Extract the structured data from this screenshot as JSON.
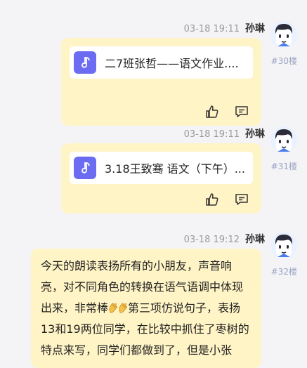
{
  "posts": [
    {
      "time": "03-18 19:11",
      "author": "孙琳",
      "floor": "#30楼",
      "attachment": "二7班张哲——语文作业...."
    },
    {
      "time": "03-18 19:11",
      "author": "孙琳",
      "floor": "#31楼",
      "attachment": "3.18王致骞 语文（下午）..."
    },
    {
      "time": "03-18 19:12",
      "author": "孙琳",
      "floor": "#32楼",
      "text_before": "今天的朗读表扬所有的小朋友，声音响亮，对不同角色的转换在语气语调中体现出来，非常棒",
      "text_after": "第三项仿说句子，表扬13和19两位同学，在比较中抓住了枣树的特点来写，同学们都做到了，但是小张"
    }
  ],
  "icons": {
    "attachment": "music-note-icon",
    "like": "thumbs-up-icon",
    "comment": "comment-icon",
    "emoji": "clapping-hands-icon"
  },
  "colors": {
    "bubble": "#fff4c6",
    "music_icon_bg": "#6c6cf3",
    "floor_text": "#9aa4c4"
  }
}
